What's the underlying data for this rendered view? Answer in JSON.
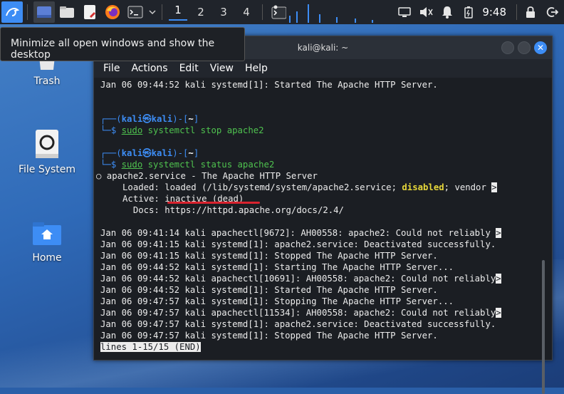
{
  "panel": {
    "workspaces": [
      "1",
      "2",
      "3",
      "4"
    ],
    "clock": "9:48"
  },
  "tooltip": "Minimize all open windows and show the desktop",
  "desktop": {
    "icons": [
      {
        "label": "Trash"
      },
      {
        "label": "File System"
      },
      {
        "label": "Home"
      }
    ]
  },
  "window": {
    "title": "kali@kali: ~",
    "menu": [
      "File",
      "Actions",
      "Edit",
      "View",
      "Help"
    ]
  },
  "terminal": {
    "line_top": "Jan 06 09:44:52 kali systemd[1]: Started The Apache HTTP Server.",
    "prompt1": {
      "user": "kali",
      "host": "kali",
      "dir": "~",
      "cmd_sudo": "sudo",
      "cmd_rest": " systemctl stop apache2"
    },
    "prompt2": {
      "user": "kali",
      "host": "kali",
      "dir": "~",
      "cmd_sudo": "sudo",
      "cmd_rest": " systemctl status apache2"
    },
    "service_line": "○ apache2.service - The Apache HTTP Server",
    "loaded_a": "     Loaded: loaded (/lib/systemd/system/apache2.service; ",
    "loaded_disabled": "disabled",
    "loaded_b": "; vendor ",
    "active": "     Active: inactive (dead)",
    "docs": "       Docs: https://httpd.apache.org/docs/2.4/",
    "log": [
      {
        "text": "Jan 06 09:41:14 kali apachectl[9672]: AH00558: apache2: Could not reliably ",
        "arrow": true
      },
      {
        "text": "Jan 06 09:41:15 kali systemd[1]: apache2.service: Deactivated successfully.",
        "arrow": false
      },
      {
        "text": "Jan 06 09:41:15 kali systemd[1]: Stopped The Apache HTTP Server.",
        "arrow": false
      },
      {
        "text": "Jan 06 09:44:52 kali systemd[1]: Starting The Apache HTTP Server...",
        "arrow": false
      },
      {
        "text": "Jan 06 09:44:52 kali apachectl[10691]: AH00558: apache2: Could not reliably",
        "arrow": true
      },
      {
        "text": "Jan 06 09:44:52 kali systemd[1]: Started The Apache HTTP Server.",
        "arrow": false
      },
      {
        "text": "Jan 06 09:47:57 kali systemd[1]: Stopping The Apache HTTP Server...",
        "arrow": false
      },
      {
        "text": "Jan 06 09:47:57 kali apachectl[11534]: AH00558: apache2: Could not reliably",
        "arrow": true
      },
      {
        "text": "Jan 06 09:47:57 kali systemd[1]: apache2.service: Deactivated successfully.",
        "arrow": false
      },
      {
        "text": "Jan 06 09:47:57 kali systemd[1]: Stopped The Apache HTTP Server.",
        "arrow": false
      }
    ],
    "arrow_glyph": ">",
    "status_line": "lines 1-15/15 (END)"
  },
  "colors": {
    "accent": "#3d8df5",
    "prompt_cmd": "#4fc24f",
    "warning": "#e6d73a",
    "annotation": "#d9232e"
  }
}
